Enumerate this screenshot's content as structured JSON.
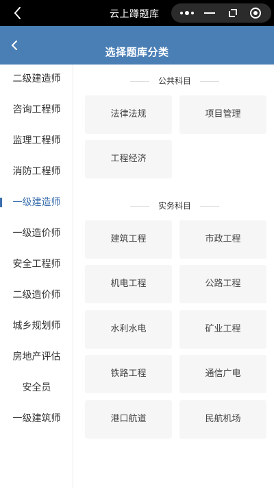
{
  "topbar": {
    "title": "云上蹲题库"
  },
  "header": {
    "title": "选择题库分类"
  },
  "sidebar": {
    "items": [
      {
        "label": "二级建造师"
      },
      {
        "label": "咨询工程师"
      },
      {
        "label": "监理工程师"
      },
      {
        "label": "消防工程师"
      },
      {
        "label": "一级建造师"
      },
      {
        "label": "一级造价师"
      },
      {
        "label": "安全工程师"
      },
      {
        "label": "二级造价师"
      },
      {
        "label": "城乡规划师"
      },
      {
        "label": "房地产评估"
      },
      {
        "label": "安全员"
      },
      {
        "label": "一级建筑师"
      }
    ],
    "active_index": 4
  },
  "sections": [
    {
      "title": "公共科目",
      "cards": [
        "法律法规",
        "项目管理",
        "工程经济"
      ]
    },
    {
      "title": "实务科目",
      "cards": [
        "建筑工程",
        "市政工程",
        "机电工程",
        "公路工程",
        "水利水电",
        "矿业工程",
        "铁路工程",
        "通信广电",
        "港口航道",
        "民航机场"
      ]
    }
  ],
  "icons": [
    "chevron-left-icon",
    "more-icon",
    "minimize-icon",
    "switch-icon",
    "record-icon"
  ],
  "colors": {
    "header": "#4a7fb6",
    "active": "#3b6fae",
    "card": "#f6f6f6"
  }
}
